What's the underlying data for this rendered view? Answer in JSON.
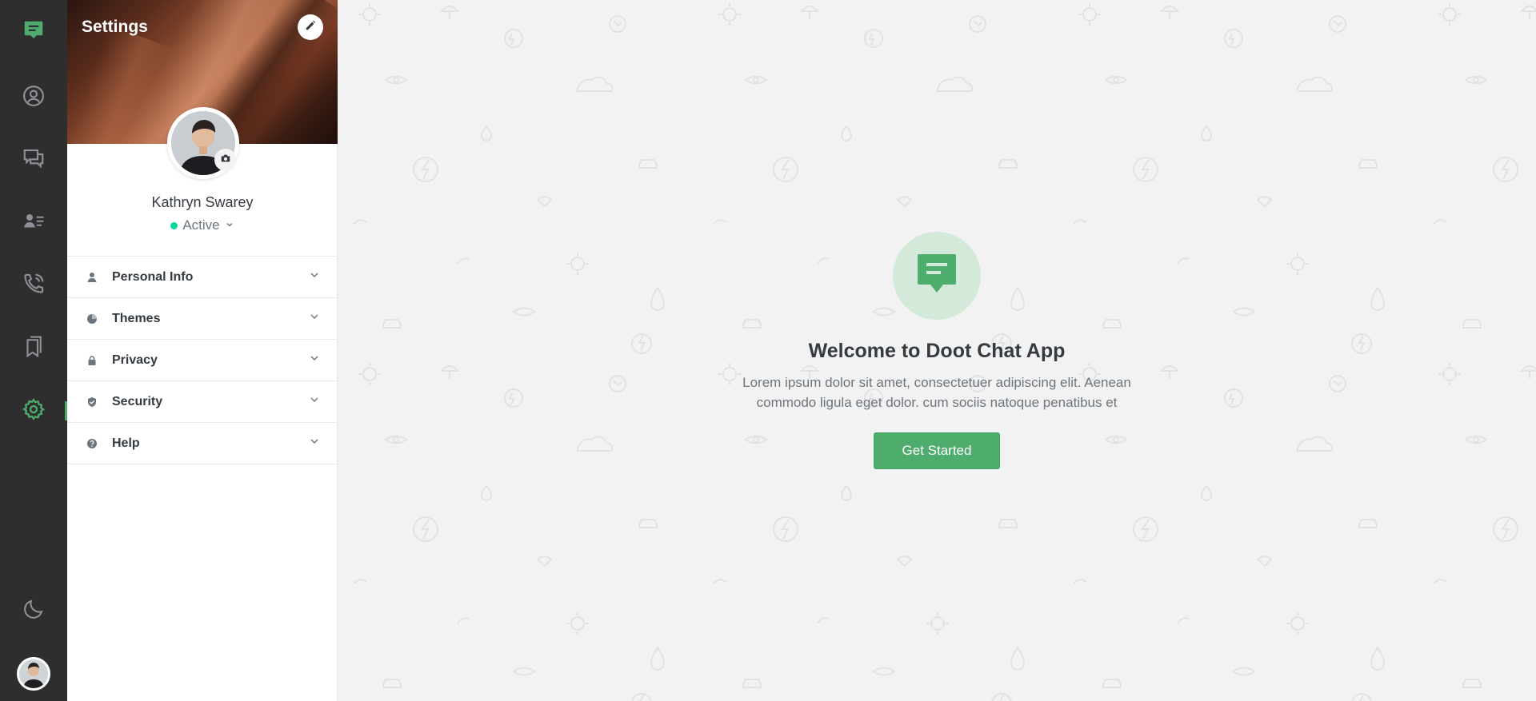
{
  "app": {
    "accent_color": "#4eac6d",
    "rail_color": "#2e2e2e"
  },
  "rail": {
    "items": [
      {
        "icon": "chat-logo-icon",
        "active": false
      },
      {
        "icon": "user-profile-icon",
        "active": false
      },
      {
        "icon": "chats-icon",
        "active": false
      },
      {
        "icon": "contacts-icon",
        "active": false
      },
      {
        "icon": "calls-icon",
        "active": false
      },
      {
        "icon": "bookmarks-icon",
        "active": false
      },
      {
        "icon": "settings-icon",
        "active": true
      }
    ],
    "bottom": [
      {
        "icon": "moon-icon"
      },
      {
        "icon": "avatar"
      }
    ]
  },
  "settings": {
    "title": "Settings",
    "user_name": "Kathryn Swarey",
    "status": "Active",
    "status_color": "#06d6a0",
    "sections": [
      {
        "label": "Personal Info",
        "icon": "user-icon"
      },
      {
        "label": "Themes",
        "icon": "palette-icon"
      },
      {
        "label": "Privacy",
        "icon": "lock-icon"
      },
      {
        "label": "Security",
        "icon": "shield-icon"
      },
      {
        "label": "Help",
        "icon": "question-icon"
      }
    ]
  },
  "welcome": {
    "title": "Welcome to Doot Chat App",
    "text_line1": "Lorem ipsum dolor sit amet, consectetuer adipiscing elit. Aenean",
    "text_line2": "commodo ligula eget dolor. cum sociis natoque penatibus et",
    "button": "Get Started"
  }
}
